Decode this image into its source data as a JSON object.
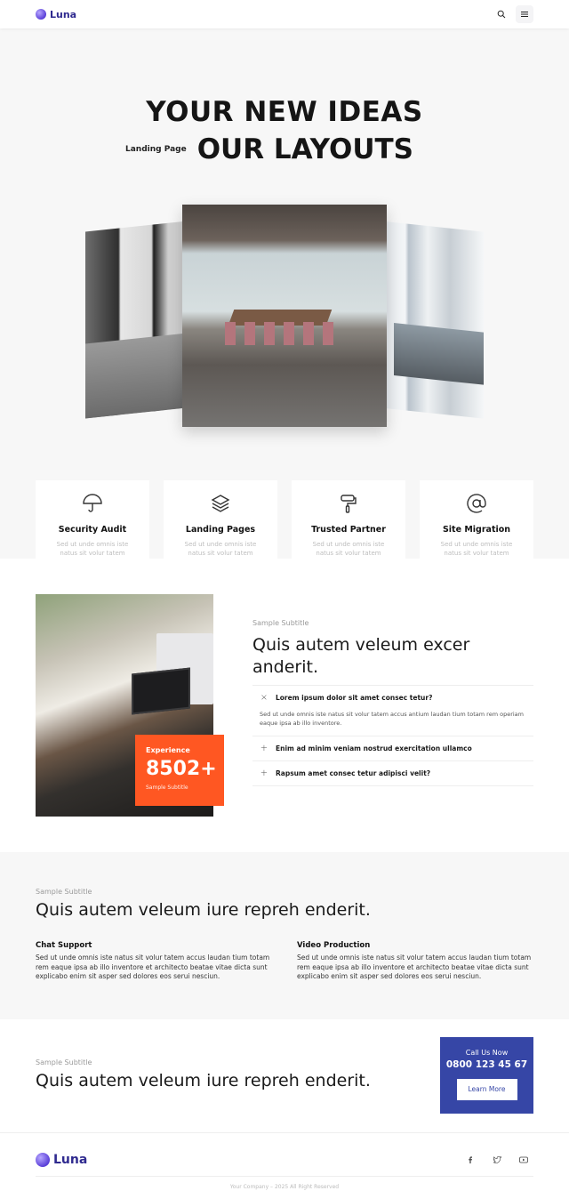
{
  "header": {
    "brand": "Luna",
    "icons": [
      "search-icon",
      "menu-icon"
    ]
  },
  "hero": {
    "line1": "YOUR NEW IDEAS",
    "tag": "Landing Page",
    "line2": "OUR LAYOUTS"
  },
  "features": [
    {
      "icon": "umbrella-icon",
      "title": "Security Audit",
      "text": "Sed ut unde omnis iste natus sit volur tatem accus."
    },
    {
      "icon": "layers-icon",
      "title": "Landing Pages",
      "text": "Sed ut unde omnis iste natus sit volur tatem accus."
    },
    {
      "icon": "paint-roller-icon",
      "title": "Trusted Partner",
      "text": "Sed ut unde omnis iste natus sit volur tatem accus."
    },
    {
      "icon": "at-icon",
      "title": "Site Migration",
      "text": "Sed ut unde omnis iste natus sit volur tatem accus."
    }
  ],
  "about": {
    "experience_label": "Experience",
    "experience_value": "8502+",
    "experience_sub": "Sample Subtitle",
    "subtitle": "Sample Subtitle",
    "heading": "Quis autem veleum excer anderit.",
    "faq": [
      {
        "question": "Lorem ipsum dolor sit amet consec tetur?",
        "answer": "Sed ut unde omnis iste natus sit volur tatem accus antium laudan tium totam rem operiam eaque ipsa ab illo inventore.",
        "open": true,
        "toggle": "×"
      },
      {
        "question": "Enim ad minim veniam nostrud exercitation ullamco",
        "open": false,
        "toggle": "+"
      },
      {
        "question": "Rapsum amet consec tetur adipisci velit?",
        "open": false,
        "toggle": "+"
      }
    ]
  },
  "services": {
    "subtitle": "Sample Subtitle",
    "heading": "Quis autem veleum iure repreh enderit.",
    "items": [
      {
        "title": "Chat Support",
        "text": "Sed ut unde omnis iste natus sit volur tatem accus laudan tium totam rem eaque ipsa ab illo inventore et architecto beatae vitae dicta sunt explicabo enim sit asper sed dolores eos serui nesciun."
      },
      {
        "title": "Video Production",
        "text": "Sed ut unde omnis iste natus sit volur tatem accus laudan tium totam rem eaque ipsa ab illo inventore et architecto beatae vitae dicta sunt explicabo enim sit asper sed dolores eos serui nesciun."
      }
    ]
  },
  "cta": {
    "subtitle": "Sample Subtitle",
    "heading": "Quis autem veleum iure repreh enderit.",
    "call_label": "Call Us Now",
    "phone": "0800 123 45 67",
    "button": "Learn More",
    "box_color": "#3646a6"
  },
  "footer": {
    "brand": "Luna",
    "socials": [
      "facebook-icon",
      "twitter-icon",
      "youtube-icon"
    ],
    "copyright": "Your Company – 2025 All Right Reserved"
  },
  "colors": {
    "accent": "#ff5722",
    "brand": "#2f2a8f",
    "cta": "#3646a6"
  }
}
